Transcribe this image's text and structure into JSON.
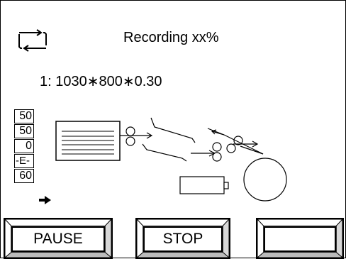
{
  "header": {
    "status_text": "Recording  xx%",
    "sync_icon": "sync-arrows-icon"
  },
  "job": {
    "line": "1:  1030∗800∗0.30"
  },
  "counters": [
    "50",
    "50",
    "0",
    "-E-",
    "60"
  ],
  "indicator_icon": "right-arrow-icon",
  "diagram": {
    "icons": [
      "paper-stack-icon",
      "roller-pair-icon",
      "battery-icon",
      "circle-drum-icon"
    ]
  },
  "buttons": {
    "pause_label": "PAUSE",
    "stop_label": "STOP",
    "blank_label": ""
  }
}
